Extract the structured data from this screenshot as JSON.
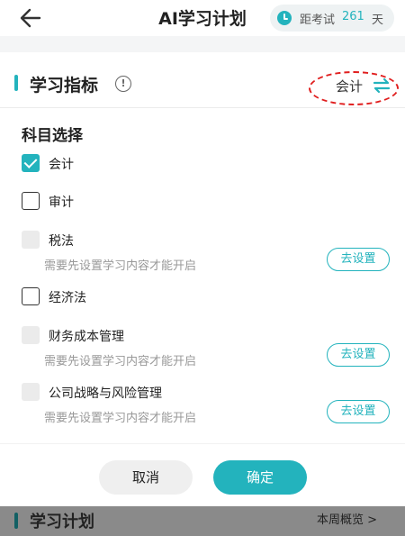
{
  "header": {
    "title": "AI学习计划",
    "exam_prefix": "距考试",
    "exam_days": "261",
    "exam_suffix": "天"
  },
  "section": {
    "title": "学习指标",
    "info": "!",
    "current_subject": "会计"
  },
  "subject_select": {
    "title": "科目选择",
    "items": [
      {
        "label": "会计",
        "state": "checked"
      },
      {
        "label": "审计",
        "state": "unchecked"
      },
      {
        "label": "税法",
        "state": "disabled",
        "note": "需要先设置学习内容才能开启",
        "action": "去设置"
      },
      {
        "label": "经济法",
        "state": "unchecked"
      },
      {
        "label": "财务成本管理",
        "state": "disabled",
        "note": "需要先设置学习内容才能开启",
        "action": "去设置"
      },
      {
        "label": "公司战略与风险管理",
        "state": "disabled",
        "note": "需要先设置学习内容才能开启",
        "action": "去设置"
      }
    ]
  },
  "actions": {
    "cancel": "取消",
    "confirm": "确定"
  },
  "background_page": {
    "section_title": "学习计划",
    "link": "本周概览 >"
  },
  "colors": {
    "accent": "#23b3bd",
    "highlight_ring": "#e01e1e"
  }
}
